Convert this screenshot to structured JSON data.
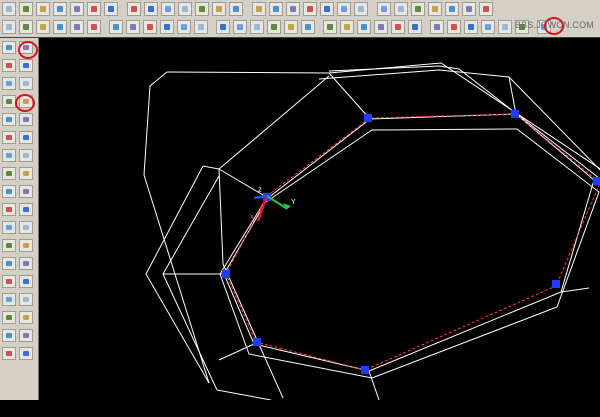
{
  "watermark": "BBS.JCWCN.COM",
  "left_toolbar_text": "A",
  "ucs_labels": {
    "x": "X",
    "y": "Y",
    "z": "Z"
  },
  "colors": {
    "toolbar_bg": "#d4d0c8",
    "viewport_bg": "#000000",
    "wire": "#ffffff",
    "path_dashed": "#ff3b3b",
    "vertex_grip": "#1f3cff",
    "highlight_circle": "#d8141c",
    "axis_x": "#e8151b",
    "axis_y": "#22c63a",
    "axis_z": "#1e4fff"
  },
  "icons": {
    "row1": [
      "sphere-icon",
      "cone-icon",
      "cylinder-icon",
      "torus-icon",
      "box-icon",
      "wedge-icon",
      "revolve-icon",
      "extrude-icon",
      "slice-icon",
      "section-icon",
      "interfere-icon",
      "union-icon",
      "subtract-icon",
      "intersect-icon",
      "solid-edit-icon",
      "render-icon",
      "light-icon",
      "material-icon",
      "view-front-icon",
      "view-back-icon",
      "view-left-icon",
      "view-right-icon",
      "view-top-icon",
      "view-bottom-icon",
      "shade-icon",
      "orbit-icon",
      "3d-view-icon",
      "camera-icon"
    ],
    "row2": [
      "ring-icon",
      "ellipse-icon",
      "donut-icon",
      "3d-face-icon",
      "3d-mesh-icon",
      "3d-box-icon",
      "pyramid-icon",
      "dome-icon",
      "dish-icon",
      "edge-icon",
      "copy-3d-icon",
      "mirror-3d-icon",
      "rotate-3d-icon",
      "align-icon",
      "align-3d-icon",
      "array-3d-icon",
      "solview-icon",
      "soldraw-icon",
      "solprof-icon",
      "ucs-icon",
      "ucs-world-icon",
      "ucs-previous-icon",
      "ucs-face-icon",
      "ucs-object-icon",
      "ucs-view-icon",
      "ucs-origin-icon",
      "ucs-zaxis-icon",
      "ucs-3point-icon",
      "ucs-x-icon",
      "ucs-y-icon",
      "ucs-z-icon"
    ],
    "left": [
      "line-icon",
      "xline-icon",
      "polyline-icon",
      "polygon-icon",
      "rectangle-icon",
      "arc-icon",
      "circle-icon",
      "revcloud-icon",
      "spline-icon",
      "ellipse-icon",
      "insert-block-icon",
      "make-block-icon",
      "point-icon",
      "hatch-icon",
      "region-icon",
      "table-icon",
      "multiline-text-icon",
      "erase-icon",
      "copy-icon",
      "mirror-icon",
      "offset-icon",
      "array-icon",
      "move-icon",
      "rotate-icon",
      "scale-icon",
      "stretch-icon",
      "trim-icon",
      "extend-icon",
      "break-icon",
      "join-icon",
      "chamfer-icon",
      "fillet-icon",
      "explode-icon",
      "edit-polyline-icon",
      "properties-icon",
      "match-properties-icon"
    ]
  }
}
